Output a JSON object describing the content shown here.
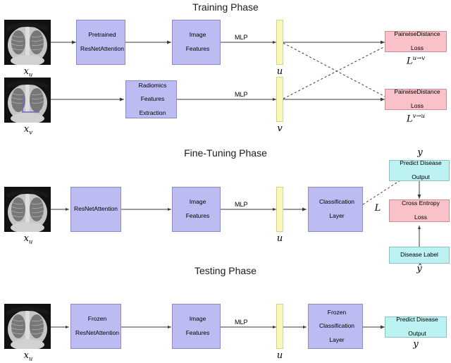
{
  "figure": {
    "kind": "method-pipeline-diagram",
    "phases": [
      "Training Phase",
      "Fine-Tuning Phase",
      "Testing Phase"
    ]
  },
  "colors": {
    "module_fill": "#bcbcf2",
    "module_stroke": "#8b8bc4",
    "loss_fill": "#f9c2c8",
    "loss_stroke": "#c98d94",
    "output_fill": "#bdf2f2",
    "output_stroke": "#89c2c2",
    "embedding_fill": "#f9f7b9",
    "embedding_stroke": "#d6d28a",
    "arrow": "#3a3a3a",
    "annotation": "#6b6bc0"
  },
  "training": {
    "title": "Training Phase",
    "input_image_u_label": "x",
    "input_image_u_sub": "u",
    "input_image_v_label": "x",
    "input_image_v_sub": "v",
    "backbone": "Pretrained\nResNetAttention",
    "backbone_line1": "Pretrained",
    "backbone_line2": "ResNetAttention",
    "image_features_line1": "Image",
    "image_features_line2": "Features",
    "radiomics_line1": "Radiomics",
    "radiomics_line2": "Features",
    "radiomics_line3": "Extraction",
    "mlp_top": "MLP",
    "mlp_bottom": "MLP",
    "embedding_u": "u",
    "embedding_v": "v",
    "loss_top_line1": "PairwiseDistance",
    "loss_top_line2": "Loss",
    "loss_bottom_line1": "PairwiseDistance",
    "loss_bottom_line2": "Loss",
    "loss_top_symbol": "L",
    "loss_top_superscript": "u→v",
    "loss_bottom_symbol": "L",
    "loss_bottom_superscript": "v→u"
  },
  "finetuning": {
    "title": "Fine-Tuning Phase",
    "input_image_label": "x",
    "input_image_sub": "u",
    "backbone": "ResNetAttention",
    "image_features_line1": "Image",
    "image_features_line2": "Features",
    "mlp": "MLP",
    "embedding_u": "u",
    "classifier_line1": "Classification",
    "classifier_line2": "Layer",
    "predict_line1": "Predict Disease",
    "predict_line2": "Output",
    "predict_symbol": "y",
    "loss_line1": "Cross Entropy",
    "loss_line2": "Loss",
    "loss_symbol": "L",
    "label_box": "Disease Label",
    "label_symbol": "ŷ"
  },
  "testing": {
    "title": "Testing Phase",
    "input_image_label": "x",
    "input_image_sub": "u",
    "backbone_line1": "Frozen",
    "backbone_line2": "ResNetAttention",
    "image_features_line1": "Image",
    "image_features_line2": "Features",
    "mlp": "MLP",
    "embedding_u": "u",
    "classifier_line1": "Frozen",
    "classifier_line2": "Classification",
    "classifier_line3": "Layer",
    "predict_line1": "Predict Disease",
    "predict_line2": "Output",
    "predict_symbol": "y"
  }
}
